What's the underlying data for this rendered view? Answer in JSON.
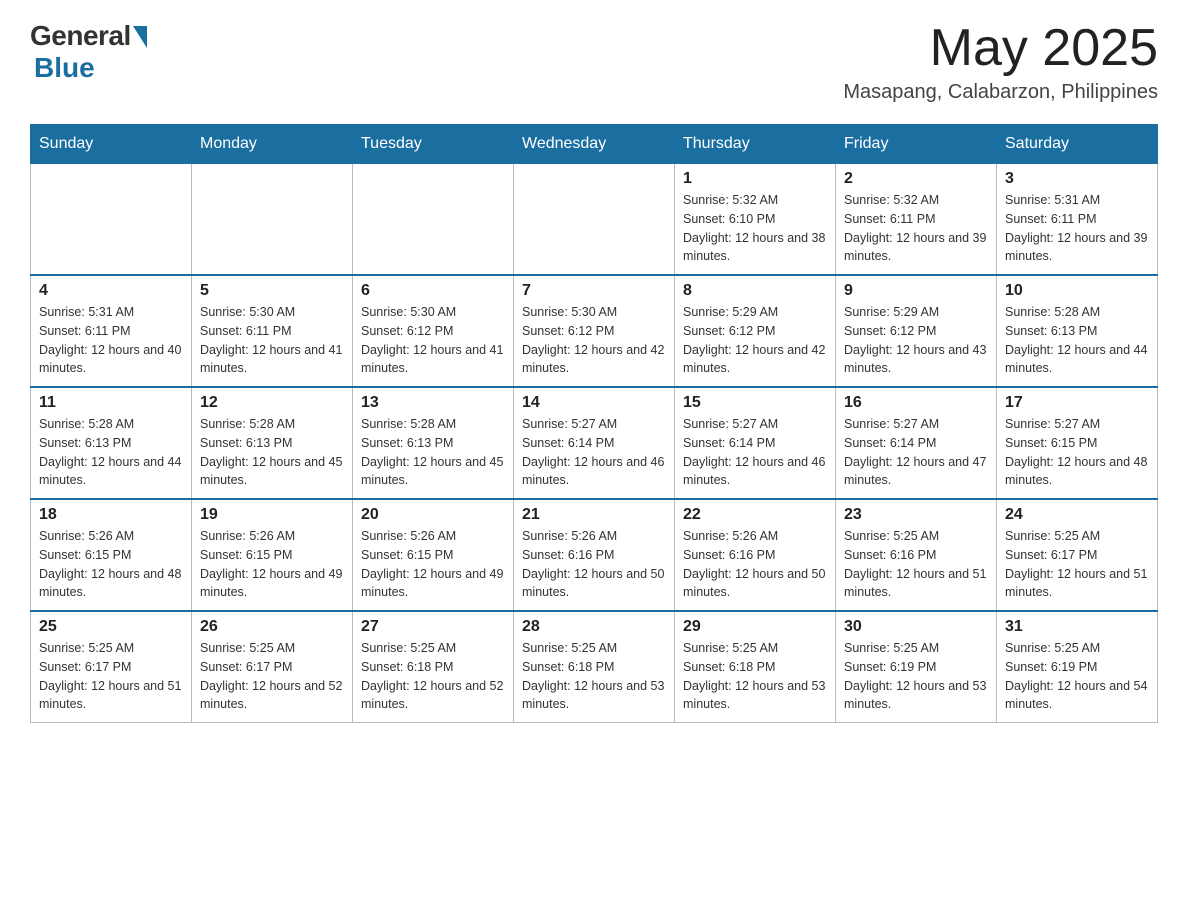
{
  "logo": {
    "general": "General",
    "blue": "Blue"
  },
  "header": {
    "month_year": "May 2025",
    "location": "Masapang, Calabarzon, Philippines"
  },
  "days_of_week": [
    "Sunday",
    "Monday",
    "Tuesday",
    "Wednesday",
    "Thursday",
    "Friday",
    "Saturday"
  ],
  "weeks": [
    {
      "days": [
        {
          "num": "",
          "info": ""
        },
        {
          "num": "",
          "info": ""
        },
        {
          "num": "",
          "info": ""
        },
        {
          "num": "",
          "info": ""
        },
        {
          "num": "1",
          "info": "Sunrise: 5:32 AM\nSunset: 6:10 PM\nDaylight: 12 hours and 38 minutes."
        },
        {
          "num": "2",
          "info": "Sunrise: 5:32 AM\nSunset: 6:11 PM\nDaylight: 12 hours and 39 minutes."
        },
        {
          "num": "3",
          "info": "Sunrise: 5:31 AM\nSunset: 6:11 PM\nDaylight: 12 hours and 39 minutes."
        }
      ]
    },
    {
      "days": [
        {
          "num": "4",
          "info": "Sunrise: 5:31 AM\nSunset: 6:11 PM\nDaylight: 12 hours and 40 minutes."
        },
        {
          "num": "5",
          "info": "Sunrise: 5:30 AM\nSunset: 6:11 PM\nDaylight: 12 hours and 41 minutes."
        },
        {
          "num": "6",
          "info": "Sunrise: 5:30 AM\nSunset: 6:12 PM\nDaylight: 12 hours and 41 minutes."
        },
        {
          "num": "7",
          "info": "Sunrise: 5:30 AM\nSunset: 6:12 PM\nDaylight: 12 hours and 42 minutes."
        },
        {
          "num": "8",
          "info": "Sunrise: 5:29 AM\nSunset: 6:12 PM\nDaylight: 12 hours and 42 minutes."
        },
        {
          "num": "9",
          "info": "Sunrise: 5:29 AM\nSunset: 6:12 PM\nDaylight: 12 hours and 43 minutes."
        },
        {
          "num": "10",
          "info": "Sunrise: 5:28 AM\nSunset: 6:13 PM\nDaylight: 12 hours and 44 minutes."
        }
      ]
    },
    {
      "days": [
        {
          "num": "11",
          "info": "Sunrise: 5:28 AM\nSunset: 6:13 PM\nDaylight: 12 hours and 44 minutes."
        },
        {
          "num": "12",
          "info": "Sunrise: 5:28 AM\nSunset: 6:13 PM\nDaylight: 12 hours and 45 minutes."
        },
        {
          "num": "13",
          "info": "Sunrise: 5:28 AM\nSunset: 6:13 PM\nDaylight: 12 hours and 45 minutes."
        },
        {
          "num": "14",
          "info": "Sunrise: 5:27 AM\nSunset: 6:14 PM\nDaylight: 12 hours and 46 minutes."
        },
        {
          "num": "15",
          "info": "Sunrise: 5:27 AM\nSunset: 6:14 PM\nDaylight: 12 hours and 46 minutes."
        },
        {
          "num": "16",
          "info": "Sunrise: 5:27 AM\nSunset: 6:14 PM\nDaylight: 12 hours and 47 minutes."
        },
        {
          "num": "17",
          "info": "Sunrise: 5:27 AM\nSunset: 6:15 PM\nDaylight: 12 hours and 48 minutes."
        }
      ]
    },
    {
      "days": [
        {
          "num": "18",
          "info": "Sunrise: 5:26 AM\nSunset: 6:15 PM\nDaylight: 12 hours and 48 minutes."
        },
        {
          "num": "19",
          "info": "Sunrise: 5:26 AM\nSunset: 6:15 PM\nDaylight: 12 hours and 49 minutes."
        },
        {
          "num": "20",
          "info": "Sunrise: 5:26 AM\nSunset: 6:15 PM\nDaylight: 12 hours and 49 minutes."
        },
        {
          "num": "21",
          "info": "Sunrise: 5:26 AM\nSunset: 6:16 PM\nDaylight: 12 hours and 50 minutes."
        },
        {
          "num": "22",
          "info": "Sunrise: 5:26 AM\nSunset: 6:16 PM\nDaylight: 12 hours and 50 minutes."
        },
        {
          "num": "23",
          "info": "Sunrise: 5:25 AM\nSunset: 6:16 PM\nDaylight: 12 hours and 51 minutes."
        },
        {
          "num": "24",
          "info": "Sunrise: 5:25 AM\nSunset: 6:17 PM\nDaylight: 12 hours and 51 minutes."
        }
      ]
    },
    {
      "days": [
        {
          "num": "25",
          "info": "Sunrise: 5:25 AM\nSunset: 6:17 PM\nDaylight: 12 hours and 51 minutes."
        },
        {
          "num": "26",
          "info": "Sunrise: 5:25 AM\nSunset: 6:17 PM\nDaylight: 12 hours and 52 minutes."
        },
        {
          "num": "27",
          "info": "Sunrise: 5:25 AM\nSunset: 6:18 PM\nDaylight: 12 hours and 52 minutes."
        },
        {
          "num": "28",
          "info": "Sunrise: 5:25 AM\nSunset: 6:18 PM\nDaylight: 12 hours and 53 minutes."
        },
        {
          "num": "29",
          "info": "Sunrise: 5:25 AM\nSunset: 6:18 PM\nDaylight: 12 hours and 53 minutes."
        },
        {
          "num": "30",
          "info": "Sunrise: 5:25 AM\nSunset: 6:19 PM\nDaylight: 12 hours and 53 minutes."
        },
        {
          "num": "31",
          "info": "Sunrise: 5:25 AM\nSunset: 6:19 PM\nDaylight: 12 hours and 54 minutes."
        }
      ]
    }
  ]
}
